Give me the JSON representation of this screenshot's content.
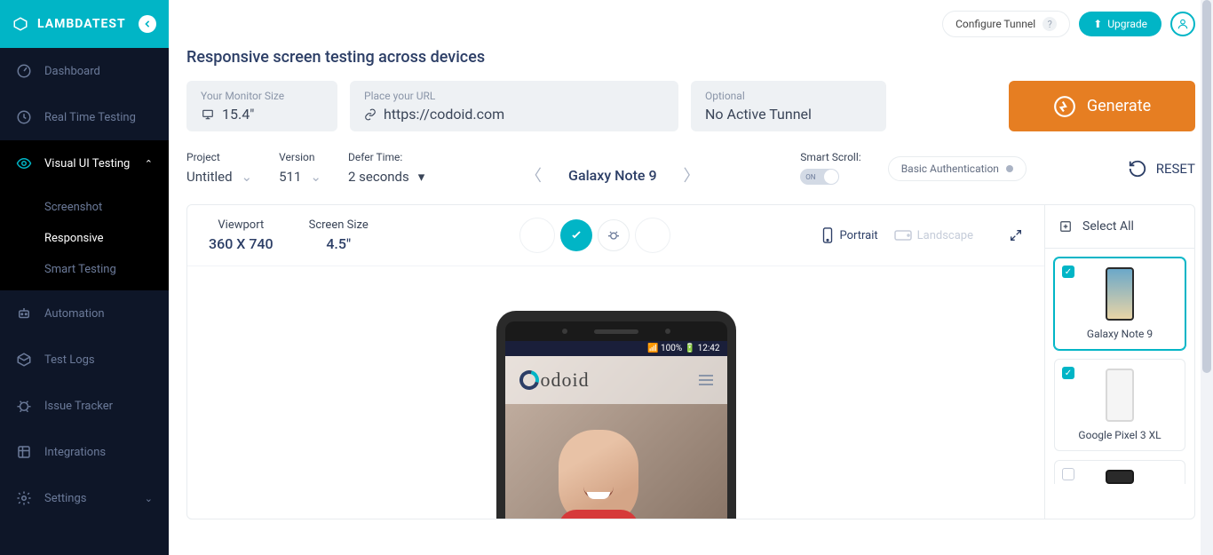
{
  "brand": "LAMBDATEST",
  "topbar": {
    "tunnel": "Configure Tunnel",
    "upgrade": "Upgrade"
  },
  "sidebar": {
    "items": [
      {
        "label": "Dashboard"
      },
      {
        "label": "Real Time Testing"
      },
      {
        "label": "Visual UI Testing"
      },
      {
        "label": "Automation"
      },
      {
        "label": "Test Logs"
      },
      {
        "label": "Issue Tracker"
      },
      {
        "label": "Integrations"
      },
      {
        "label": "Settings"
      }
    ],
    "sub": [
      {
        "label": "Screenshot"
      },
      {
        "label": "Responsive"
      },
      {
        "label": "Smart Testing"
      }
    ]
  },
  "page": {
    "title": "Responsive screen testing across devices",
    "monitor_lbl": "Your Monitor Size",
    "monitor_val": "15.4\"",
    "url_lbl": "Place your URL",
    "url_val": "https://codoid.com",
    "tunnel_lbl": "Optional",
    "tunnel_val": "No Active Tunnel",
    "generate": "Generate"
  },
  "filters": {
    "project_lbl": "Project",
    "project_val": "Untitled",
    "version_lbl": "Version",
    "version_val": "511",
    "defer_lbl": "Defer Time:",
    "defer_val": "2 seconds",
    "device": "Galaxy Note 9",
    "smart_scroll_lbl": "Smart Scroll:",
    "smart_scroll_val": "ON",
    "basic_auth": "Basic Authentication",
    "reset": "RESET"
  },
  "preview": {
    "viewport_lbl": "Viewport",
    "viewport_val": "360 X 740",
    "screen_lbl": "Screen Size",
    "screen_val": "4.5\"",
    "portrait": "Portrait",
    "landscape": "Landscape",
    "status_bar": "📶 100% 🔋 12:42",
    "site_brand": "odoid"
  },
  "device_list": {
    "select_all": "Select All",
    "items": [
      {
        "name": "Galaxy Note 9"
      },
      {
        "name": "Google Pixel 3 XL"
      }
    ]
  }
}
